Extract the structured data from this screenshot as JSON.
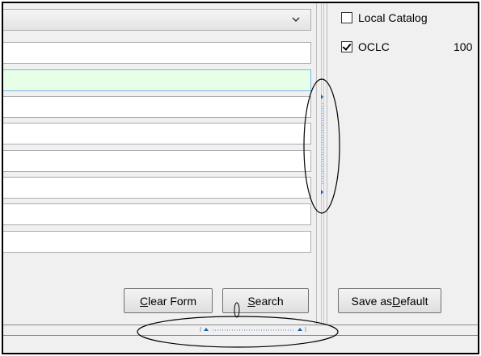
{
  "form": {
    "fields": [
      {
        "value": "",
        "placeholder": ""
      },
      {
        "value": "",
        "placeholder": ""
      },
      {
        "value": "",
        "placeholder": ""
      },
      {
        "value": "",
        "placeholder": ""
      },
      {
        "value": "",
        "placeholder": ""
      },
      {
        "value": "",
        "placeholder": ""
      },
      {
        "value": "",
        "placeholder": ""
      },
      {
        "value": "",
        "placeholder": ""
      }
    ],
    "clear_button": {
      "pre": "",
      "accel": "C",
      "post": "lear Form"
    },
    "search_button": {
      "pre": "",
      "accel": "S",
      "post": "earch"
    }
  },
  "sources": {
    "local_catalog": {
      "label": "Local Catalog",
      "checked": false
    },
    "oclc": {
      "label": "OCLC",
      "checked": true,
      "limit": "100"
    }
  },
  "save_default_button": {
    "pre": "Save as ",
    "accel": "D",
    "post": "efault"
  },
  "icons": {
    "dropdown": "chevron-down-icon",
    "checkbox": "checkbox-icon"
  },
  "colors": {
    "focused_field_bg": "#e6ffe6",
    "focused_field_border": "#7eb4ea"
  }
}
